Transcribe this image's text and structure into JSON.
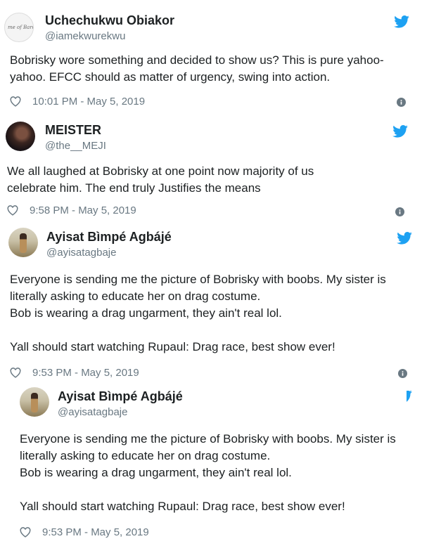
{
  "tweets": [
    {
      "name": "Uchechukwu Obiakor",
      "handle": "@iamekwurekwu",
      "avatar_text": "me of Bardo",
      "body": [
        "Bobrisky wore something and decided to show us? This is pure yahoo-yahoo. EFCC should as matter of urgency, swing into action."
      ],
      "timestamp": "10:01 PM - May 5, 2019"
    },
    {
      "name": "MEISTER",
      "handle": "@the__MEJI",
      "body": [
        "We all laughed at Bobrisky at one point now majority of us celebrate him.  The end truly Justifies the means"
      ],
      "timestamp": "9:58 PM - May 5, 2019"
    },
    {
      "name": "Ayisat Bìmpé Agbájé",
      "handle": "@ayisatagbaje",
      "body": [
        "Everyone is sending me the picture of Bobrisky with boobs. My sister is literally asking to educate her on drag costume.",
        "Bob is wearing a drag ungarment, they ain't real lol.",
        "",
        "Yall should start watching Rupaul: Drag race, best show ever!"
      ],
      "timestamp": "9:53 PM - May 5, 2019"
    },
    {
      "name": "Ayisat Bìmpé Agbájé",
      "handle": "@ayisatagbaje",
      "body": [
        "Everyone is sending me the picture of Bobrisky with boobs. My sister is literally asking to educate her on drag costume.",
        "Bob is wearing a drag ungarment, they ain't real lol.",
        "",
        "Yall should start watching Rupaul: Drag race, best show ever!"
      ],
      "timestamp": "9:53 PM - May 5, 2019"
    }
  ],
  "colors": {
    "twitter_blue": "#1da1f2",
    "meta_gray": "#697882",
    "text": "#1c2022"
  },
  "icons": [
    "twitter-bird-icon",
    "heart-icon",
    "info-icon"
  ]
}
